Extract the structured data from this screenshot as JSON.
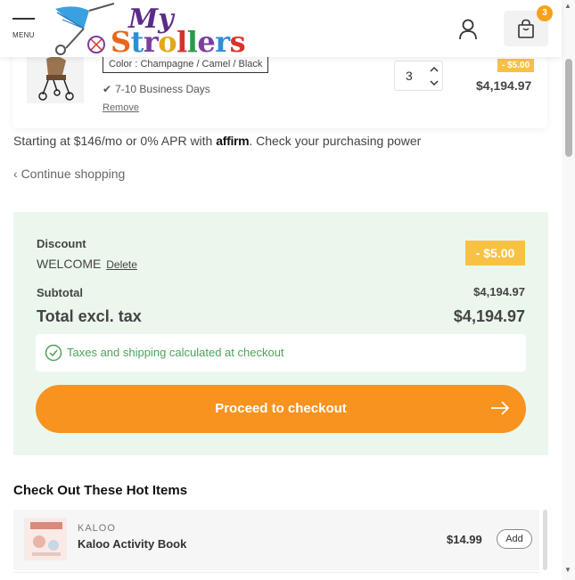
{
  "header": {
    "menu_label": "MENU",
    "logo_my": "My",
    "logo_strollers": [
      "S",
      "t",
      "r",
      "o",
      "l",
      "l",
      "e",
      "r",
      "s"
    ],
    "cart_count": "3"
  },
  "line_item": {
    "variant": "Color : Champagne / Camel / Black",
    "delivery": "7-10 Business Days",
    "remove_label": "Remove",
    "quantity": "3",
    "discount": "- $5.00",
    "price": "$4,194.97"
  },
  "affirm": {
    "prefix": "Starting at $146/mo or 0% APR with ",
    "logo": "affirm",
    "suffix": ". Check your purchasing power"
  },
  "continue_label": "Continue shopping",
  "summary": {
    "discount_label": "Discount",
    "discount_code": "WELCOME",
    "delete_label": "Delete",
    "discount_value": "- $5.00",
    "subtotal_label": "Subtotal",
    "subtotal_value": "$4,194.97",
    "total_label": "Total excl. tax",
    "total_value": "$4,194.97",
    "notice": "Taxes and shipping calculated at checkout",
    "checkout_label": "Proceed to checkout"
  },
  "hot_items": {
    "title": "Check Out These Hot Items",
    "items": [
      {
        "brand": "KALOO",
        "name": "Kaloo Activity Book",
        "price": "$14.99",
        "add_label": "Add"
      }
    ]
  },
  "colors": {
    "accent": "#f7931e",
    "badge": "#f7c243",
    "summary_bg": "#ebf7ec",
    "success": "#4aa45a"
  }
}
